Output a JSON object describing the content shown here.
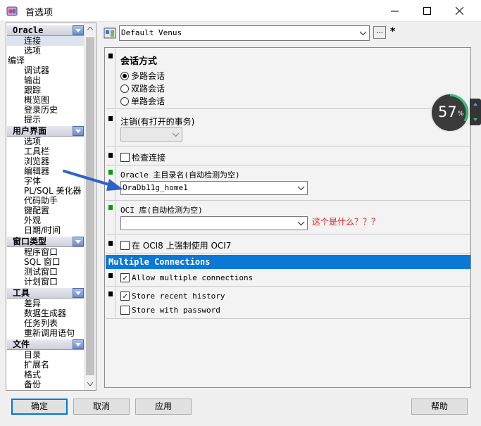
{
  "window": {
    "title": "首选项",
    "minimize_glyph": "—",
    "maximize_glyph": "☐",
    "close_glyph": "✕"
  },
  "tree": {
    "groups": [
      {
        "header": "Oracle",
        "items": [
          {
            "label": "连接",
            "selected": true
          },
          {
            "label": "选项"
          }
        ]
      },
      {
        "header": "",
        "flat_label": "编译"
      },
      {
        "header": "",
        "items": [
          {
            "label": "调试器"
          },
          {
            "label": "输出"
          },
          {
            "label": "跟踪"
          },
          {
            "label": "概览图"
          },
          {
            "label": "登录历史"
          },
          {
            "label": "提示"
          }
        ]
      },
      {
        "header": "用户界面",
        "items": [
          {
            "label": "选项"
          },
          {
            "label": "工具栏"
          },
          {
            "label": "浏览器"
          },
          {
            "label": "编辑器"
          },
          {
            "label": "字体"
          },
          {
            "label": "PL/SQL 美化器"
          },
          {
            "label": "代码助手"
          },
          {
            "label": "键配置"
          },
          {
            "label": "外观"
          },
          {
            "label": "日期/时间"
          }
        ]
      },
      {
        "header": "窗口类型",
        "items": [
          {
            "label": "程序窗口"
          },
          {
            "label": "SQL 窗口"
          },
          {
            "label": "测试窗口"
          },
          {
            "label": "计划窗口"
          }
        ]
      },
      {
        "header": "工具",
        "items": [
          {
            "label": "差异"
          },
          {
            "label": "数据生成器"
          },
          {
            "label": "任务列表"
          },
          {
            "label": "重新调用语句"
          }
        ]
      },
      {
        "header": "文件",
        "items": [
          {
            "label": "目录"
          },
          {
            "label": "扩展名"
          },
          {
            "label": "格式"
          },
          {
            "label": "备份"
          }
        ]
      }
    ]
  },
  "profile": {
    "selected": "Default Venus",
    "more_label": "…",
    "modified_mark": "*"
  },
  "session": {
    "title": "会话方式",
    "options": [
      {
        "label": "多路会话",
        "checked": true
      },
      {
        "label": "双路会话",
        "checked": false
      },
      {
        "label": "单路会话",
        "checked": false
      }
    ]
  },
  "logoff": {
    "label": "注销(有打开的事务)",
    "value": ""
  },
  "check_connection": {
    "label": "检查连接",
    "checked": false
  },
  "oracle_home": {
    "label": "Oracle 主目录名(自动检测为空)",
    "value": "OraDb11g_home1"
  },
  "oci_lib": {
    "label": "OCI 库(自动检测为空)",
    "value": ""
  },
  "force_oci7": {
    "label": "在 OCI8 上强制使用 OCI7",
    "checked": false
  },
  "multiple_connections": {
    "header": "Multiple Connections",
    "allow": {
      "label": "Allow multiple connections",
      "checked": true
    },
    "store_history": {
      "label": "Store recent history",
      "checked": true
    },
    "store_password": {
      "label": "Store with password",
      "checked": false
    }
  },
  "buttons": {
    "ok": "确定",
    "cancel": "取消",
    "apply": "应用",
    "help": "帮助"
  },
  "annotation": {
    "note": "这个是什么？？？",
    "note_color": "#e32020",
    "arrow_color": "#2f63c8"
  },
  "gauge": {
    "value": "57",
    "unit": "%"
  },
  "colors": {
    "selection_header": "#0a78d7",
    "default_button_border": "#0078d7",
    "marker_green": "#00a000"
  }
}
